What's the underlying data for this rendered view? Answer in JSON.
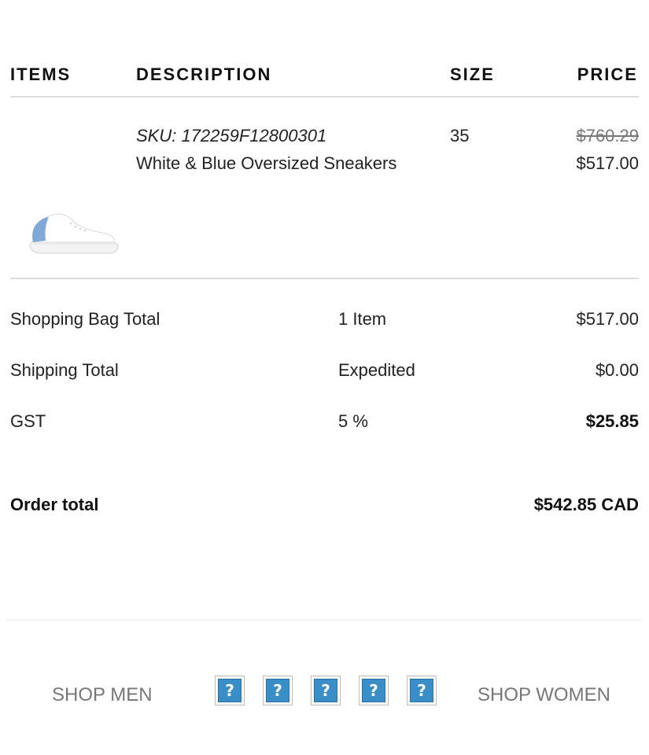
{
  "header": {
    "items": "ITEMS",
    "description": "DESCRIPTION",
    "size": "SIZE",
    "price": "PRICE"
  },
  "item": {
    "sku": "SKU: 172259F12800301",
    "name": "White & Blue Oversized Sneakers",
    "size": "35",
    "original_price": "$760.29",
    "price": "$517.00",
    "image_icon": "sneaker-image",
    "accent_color": "#7fa9d6"
  },
  "summary": {
    "bag_total_label": "Shopping Bag Total",
    "bag_total_qty": "1 Item",
    "bag_total_value": "$517.00",
    "shipping_label": "Shipping Total",
    "shipping_method": "Expedited",
    "shipping_value": "$0.00",
    "tax_label": "GST",
    "tax_rate": "5 %",
    "tax_value": "$25.85",
    "order_total_label": "Order total",
    "order_total_value": "$542.85 CAD"
  },
  "footer": {
    "shop_men": "SHOP MEN",
    "shop_women": "SHOP WOMEN",
    "social_icons": [
      {
        "icon": "broken-image-icon",
        "glyph": "?"
      },
      {
        "icon": "broken-image-icon",
        "glyph": "?"
      },
      {
        "icon": "broken-image-icon",
        "glyph": "?"
      },
      {
        "icon": "broken-image-icon",
        "glyph": "?"
      },
      {
        "icon": "broken-image-icon",
        "glyph": "?"
      }
    ]
  }
}
